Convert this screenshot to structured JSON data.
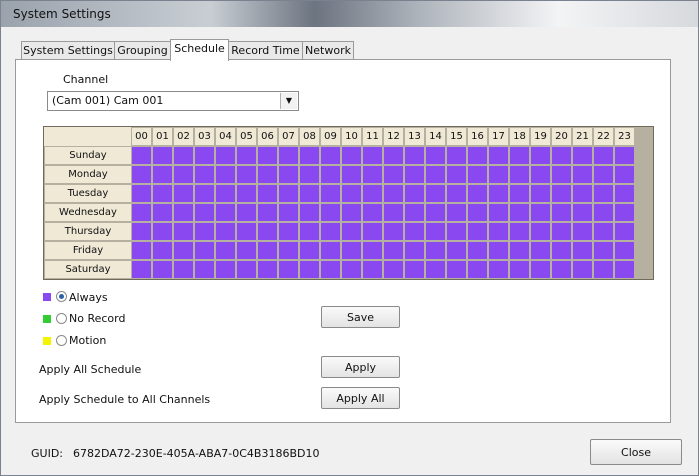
{
  "window": {
    "title": "System Settings"
  },
  "tabs": [
    {
      "label": "System Settings",
      "active": false
    },
    {
      "label": "Grouping",
      "active": false
    },
    {
      "label": "Schedule",
      "active": true
    },
    {
      "label": "Record Time",
      "active": false
    },
    {
      "label": "Network",
      "active": false
    }
  ],
  "channel": {
    "label": "Channel",
    "selected": "(Cam 001) Cam 001"
  },
  "schedule": {
    "hours": [
      "00",
      "01",
      "02",
      "03",
      "04",
      "05",
      "06",
      "07",
      "08",
      "09",
      "10",
      "11",
      "12",
      "13",
      "14",
      "15",
      "16",
      "17",
      "18",
      "19",
      "20",
      "21",
      "22",
      "23"
    ],
    "days": [
      "Sunday",
      "Monday",
      "Tuesday",
      "Wednesday",
      "Thursday",
      "Friday",
      "Saturday"
    ],
    "cell_mode": "Always"
  },
  "legend": [
    {
      "label": "Always",
      "color": "#8a49f0",
      "selected": true
    },
    {
      "label": "No Record",
      "color": "#33cc33",
      "selected": false
    },
    {
      "label": "Motion",
      "color": "#f4f400",
      "selected": false
    }
  ],
  "buttons": {
    "save": "Save",
    "apply": "Apply",
    "apply_all": "Apply All",
    "close": "Close"
  },
  "labels": {
    "apply_all_schedule": "Apply All Schedule",
    "apply_to_all_channels": "Apply Schedule to All Channels"
  },
  "guid": {
    "label": "GUID:",
    "value": "6782DA72-230E-405A-ABA7-0C4B3186BD10"
  }
}
